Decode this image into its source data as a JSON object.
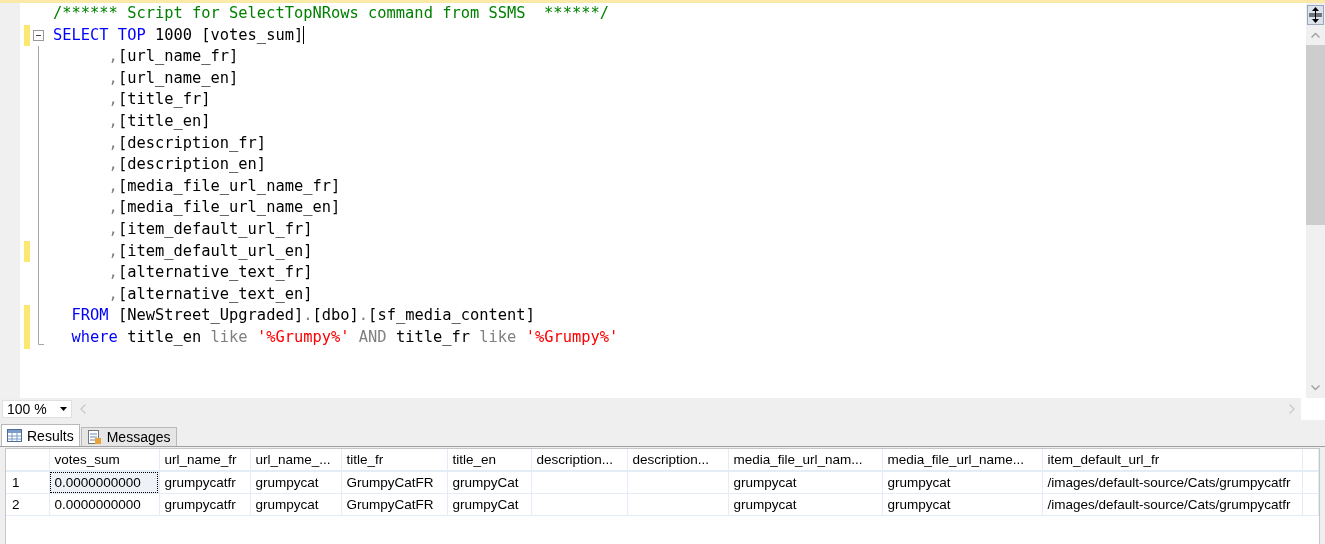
{
  "editor": {
    "lines": [
      {
        "changed": false,
        "cursor": false,
        "kind": "plain",
        "tokens": [
          {
            "text": "/****** Script for SelectTopNRows command from SSMS  ******/",
            "kind": "comment"
          }
        ]
      },
      {
        "changed": true,
        "cursor": true,
        "kind": "start",
        "tokens": [
          {
            "text": "SELECT TOP",
            "kind": "keyword"
          },
          {
            "text": " 1000 [votes_sum]",
            "kind": "plain"
          }
        ]
      },
      {
        "changed": false,
        "cursor": false,
        "kind": "inner",
        "tokens": [
          {
            "text": "      ,",
            "kind": "punct"
          },
          {
            "text": "[url_name_fr]",
            "kind": "plain"
          }
        ]
      },
      {
        "changed": false,
        "cursor": false,
        "kind": "inner",
        "tokens": [
          {
            "text": "      ,",
            "kind": "punct"
          },
          {
            "text": "[url_name_en]",
            "kind": "plain"
          }
        ]
      },
      {
        "changed": false,
        "cursor": false,
        "kind": "inner",
        "tokens": [
          {
            "text": "      ,",
            "kind": "punct"
          },
          {
            "text": "[title_fr]",
            "kind": "plain"
          }
        ]
      },
      {
        "changed": false,
        "cursor": false,
        "kind": "inner",
        "tokens": [
          {
            "text": "      ,",
            "kind": "punct"
          },
          {
            "text": "[title_en]",
            "kind": "plain"
          }
        ]
      },
      {
        "changed": false,
        "cursor": false,
        "kind": "inner",
        "tokens": [
          {
            "text": "      ,",
            "kind": "punct"
          },
          {
            "text": "[description_fr]",
            "kind": "plain"
          }
        ]
      },
      {
        "changed": false,
        "cursor": false,
        "kind": "inner",
        "tokens": [
          {
            "text": "      ,",
            "kind": "punct"
          },
          {
            "text": "[description_en]",
            "kind": "plain"
          }
        ]
      },
      {
        "changed": false,
        "cursor": false,
        "kind": "inner",
        "tokens": [
          {
            "text": "      ,",
            "kind": "punct"
          },
          {
            "text": "[media_file_url_name_fr]",
            "kind": "plain"
          }
        ]
      },
      {
        "changed": false,
        "cursor": false,
        "kind": "inner",
        "tokens": [
          {
            "text": "      ,",
            "kind": "punct"
          },
          {
            "text": "[media_file_url_name_en]",
            "kind": "plain"
          }
        ]
      },
      {
        "changed": false,
        "cursor": false,
        "kind": "inner",
        "tokens": [
          {
            "text": "      ,",
            "kind": "punct"
          },
          {
            "text": "[item_default_url_fr]",
            "kind": "plain"
          }
        ]
      },
      {
        "changed": true,
        "cursor": false,
        "kind": "inner",
        "tokens": [
          {
            "text": "      ,",
            "kind": "punct"
          },
          {
            "text": "[item_default_url_en]",
            "kind": "plain"
          }
        ]
      },
      {
        "changed": false,
        "cursor": false,
        "kind": "inner",
        "tokens": [
          {
            "text": "      ,",
            "kind": "punct"
          },
          {
            "text": "[alternative_text_fr]",
            "kind": "plain"
          }
        ]
      },
      {
        "changed": false,
        "cursor": false,
        "kind": "inner",
        "tokens": [
          {
            "text": "      ,",
            "kind": "punct"
          },
          {
            "text": "[alternative_text_en]",
            "kind": "plain"
          }
        ]
      },
      {
        "changed": true,
        "cursor": false,
        "kind": "inner",
        "tokens": [
          {
            "text": "  FROM",
            "kind": "keyword"
          },
          {
            "text": " [NewStreet_Upgraded]",
            "kind": "plain"
          },
          {
            "text": ".",
            "kind": "punct"
          },
          {
            "text": "[dbo]",
            "kind": "plain"
          },
          {
            "text": ".",
            "kind": "punct"
          },
          {
            "text": "[sf_media_content]",
            "kind": "plain"
          }
        ]
      },
      {
        "changed": true,
        "cursor": false,
        "kind": "end",
        "tokens": [
          {
            "text": "  where",
            "kind": "keyword"
          },
          {
            "text": " title_en ",
            "kind": "plain"
          },
          {
            "text": "like ",
            "kind": "operator"
          },
          {
            "text": "'%Grumpy%' ",
            "kind": "string"
          },
          {
            "text": "AND",
            "kind": "operator"
          },
          {
            "text": " title_fr ",
            "kind": "plain"
          },
          {
            "text": "like ",
            "kind": "operator"
          },
          {
            "text": "'%Grumpy%'",
            "kind": "string"
          }
        ]
      }
    ]
  },
  "zoom": {
    "value": "100 %"
  },
  "tabs": [
    {
      "label": "Results",
      "kind": "grid",
      "selected": true
    },
    {
      "label": "Messages",
      "kind": "messages",
      "selected": false
    }
  ],
  "grid": {
    "columns": [
      "votes_sum",
      "url_name_fr",
      "url_name_...",
      "title_fr",
      "title_en",
      "description...",
      "description...",
      "media_file_url_nam...",
      "media_file_url_name...",
      "item_default_url_fr"
    ],
    "rows": [
      {
        "number": "1",
        "focused": true,
        "cells": [
          "0.0000000000",
          "grumpycatfr",
          "grumpycat",
          "GrumpyCatFR",
          "grumpyCat",
          null,
          null,
          "grumpycat",
          "grumpycat",
          "/images/default-source/Cats/grumpycatfr"
        ]
      },
      {
        "number": "2",
        "focused": false,
        "cells": [
          "0.0000000000",
          "grumpycatfr",
          "grumpycat",
          "GrumpyCatFR",
          "grumpyCat",
          null,
          null,
          "grumpycat",
          "grumpycat",
          "/images/default-source/Cats/grumpycatfr"
        ]
      }
    ]
  }
}
